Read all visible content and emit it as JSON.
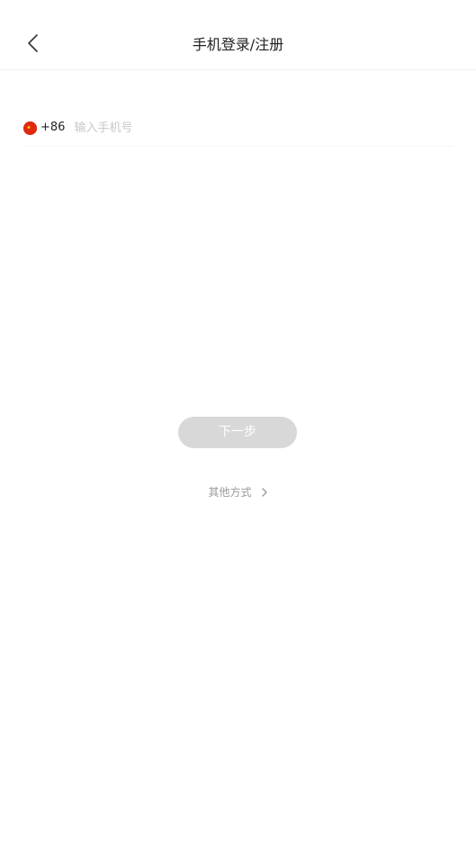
{
  "header": {
    "title": "手机登录/注册",
    "back_icon": "chevron-left-icon"
  },
  "phone": {
    "country_code": "+86",
    "flag_icon": "china-flag-icon",
    "input_value": "",
    "placeholder": "输入手机号"
  },
  "actions": {
    "next_label": "下一步",
    "other_methods_label": "其他方式",
    "other_methods_icon": "chevron-right-icon"
  },
  "colors": {
    "flag_red": "#de2910",
    "flag_star": "#ffde00",
    "button_disabled_bg": "#d8d8d8",
    "placeholder_text": "#c8c8c8",
    "secondary_text": "#999999"
  }
}
